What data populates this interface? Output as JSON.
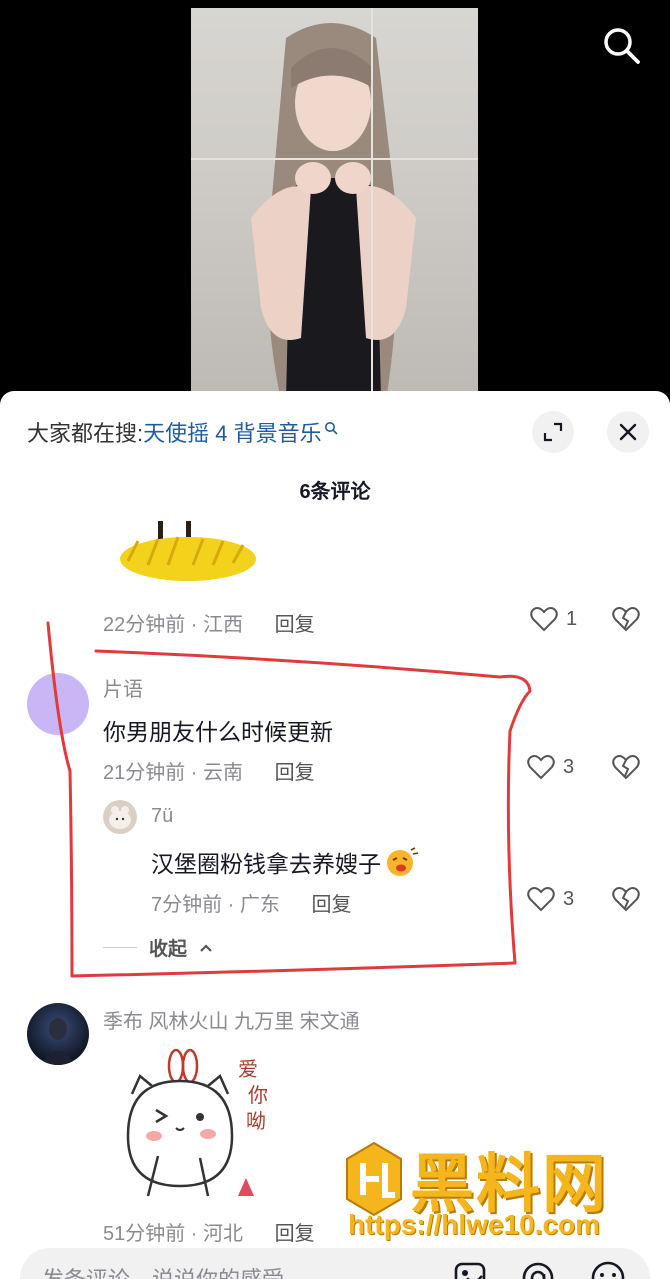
{
  "sheet": {
    "search_prefix": "大家都在搜:",
    "search_keyword": "天使摇 4 背景音乐",
    "comment_count": "6条评论"
  },
  "comments": [
    {
      "meta": "22分钟前 · 江西",
      "reply_label": "回复",
      "likes": "1"
    },
    {
      "name": "片语",
      "text": "你男朋友什么时候更新",
      "meta": "21分钟前 · 云南",
      "reply_label": "回复",
      "likes": "3",
      "avatar_color": "#c9b6f5",
      "replies": [
        {
          "name": "7ü",
          "text": "汉堡圈粉钱拿去养嫂子",
          "meta": "7分钟前 · 广东",
          "reply_label": "回复",
          "likes": "3"
        }
      ],
      "collapse_label": "收起"
    },
    {
      "name": "季布 风林火山 九万里 宋文通",
      "sticker_text": "爱你呦",
      "meta": "51分钟前 · 河北",
      "reply_label": "回复"
    }
  ],
  "input": {
    "placeholder": "发条评论，说说你的感受"
  },
  "watermark": {
    "title": "黑料网",
    "url": "https://hlwe10.com"
  },
  "icons": [
    "search-icon",
    "expand-icon",
    "close-icon",
    "heart-icon",
    "broken-heart-icon",
    "chevron-up-icon",
    "image-icon",
    "at-icon",
    "emoji-icon"
  ],
  "colors": {
    "link": "#1d5c9f",
    "annotation": "#e03a3a",
    "watermark": "#f5b51c"
  }
}
